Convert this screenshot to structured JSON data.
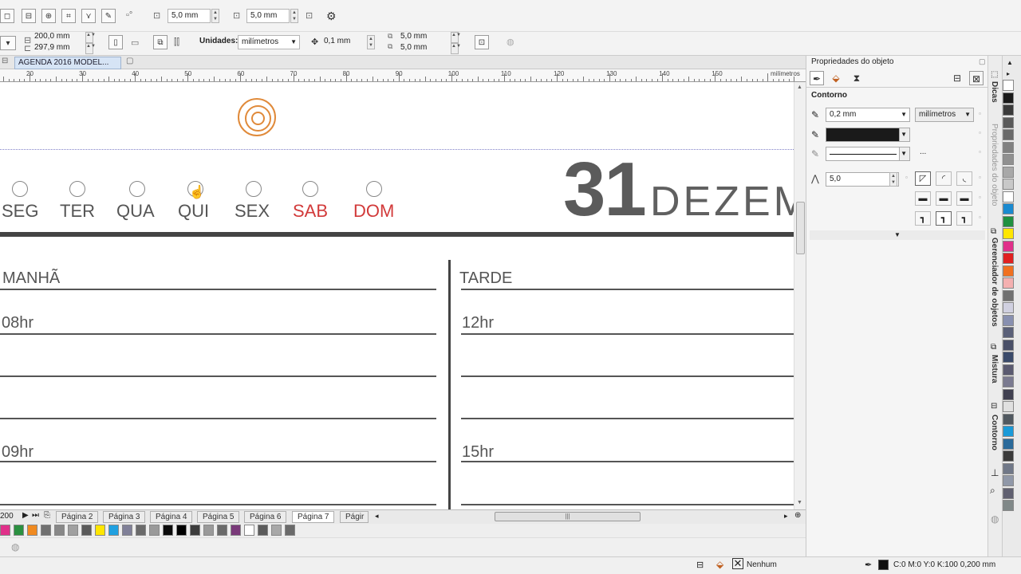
{
  "toolbar": {
    "nudge_x": "5,0 mm",
    "nudge_y": "5,0 mm",
    "width": "200,0 mm",
    "height": "297,9 mm",
    "units_label": "Unidades:",
    "units_value": "milímetros",
    "nudge": "0,1 mm",
    "dup_x": "5,0 mm",
    "dup_y": "5,0 mm"
  },
  "document": {
    "tab_title": "AGENDA 2016 MODEL..."
  },
  "ruler": {
    "unit": "milímetros",
    "ticks": [
      "20",
      "30",
      "40",
      "50",
      "60",
      "70",
      "80",
      "90",
      "100",
      "110",
      "120",
      "130",
      "140",
      "150"
    ]
  },
  "page": {
    "days": [
      {
        "label": "SEG",
        "color": "#555555"
      },
      {
        "label": "TER",
        "color": "#555555"
      },
      {
        "label": "QUA",
        "color": "#555555"
      },
      {
        "label": "QUI",
        "color": "#555555"
      },
      {
        "label": "SEX",
        "color": "#555555"
      },
      {
        "label": "SAB",
        "color": "#d23a3a"
      },
      {
        "label": "DOM",
        "color": "#d23a3a"
      }
    ],
    "date_number": "31",
    "month": "DEZEM",
    "left_section": "MANHÃ",
    "right_section": "TARDE",
    "hours_left": [
      "08hr",
      "09hr"
    ],
    "hours_right": [
      "12hr",
      "15hr"
    ]
  },
  "pages": {
    "zoom": "200",
    "tabs": [
      "Página 2",
      "Página 3",
      "Página 4",
      "Página 5",
      "Página 6",
      "Página 7",
      "Págir"
    ],
    "active": "Página 7"
  },
  "docker": {
    "title": "Propriedades do objeto",
    "section": "Contorno",
    "width": "0,2 mm",
    "units": "milímetros",
    "more": "...",
    "miter": "5,0"
  },
  "vertical_tabs": {
    "dicas": "Dicas",
    "props": "Propriedades do objeto",
    "manager": "Gerenciador de objetos",
    "mistura": "Mistura",
    "contorno": "Contorno"
  },
  "status": {
    "fill": "Nenhum",
    "outline": "C:0 M:0 Y:0 K:100  0,200 mm"
  },
  "colors": {
    "accent_red": "#d23a3a",
    "target_orange": "#e08a3a"
  }
}
